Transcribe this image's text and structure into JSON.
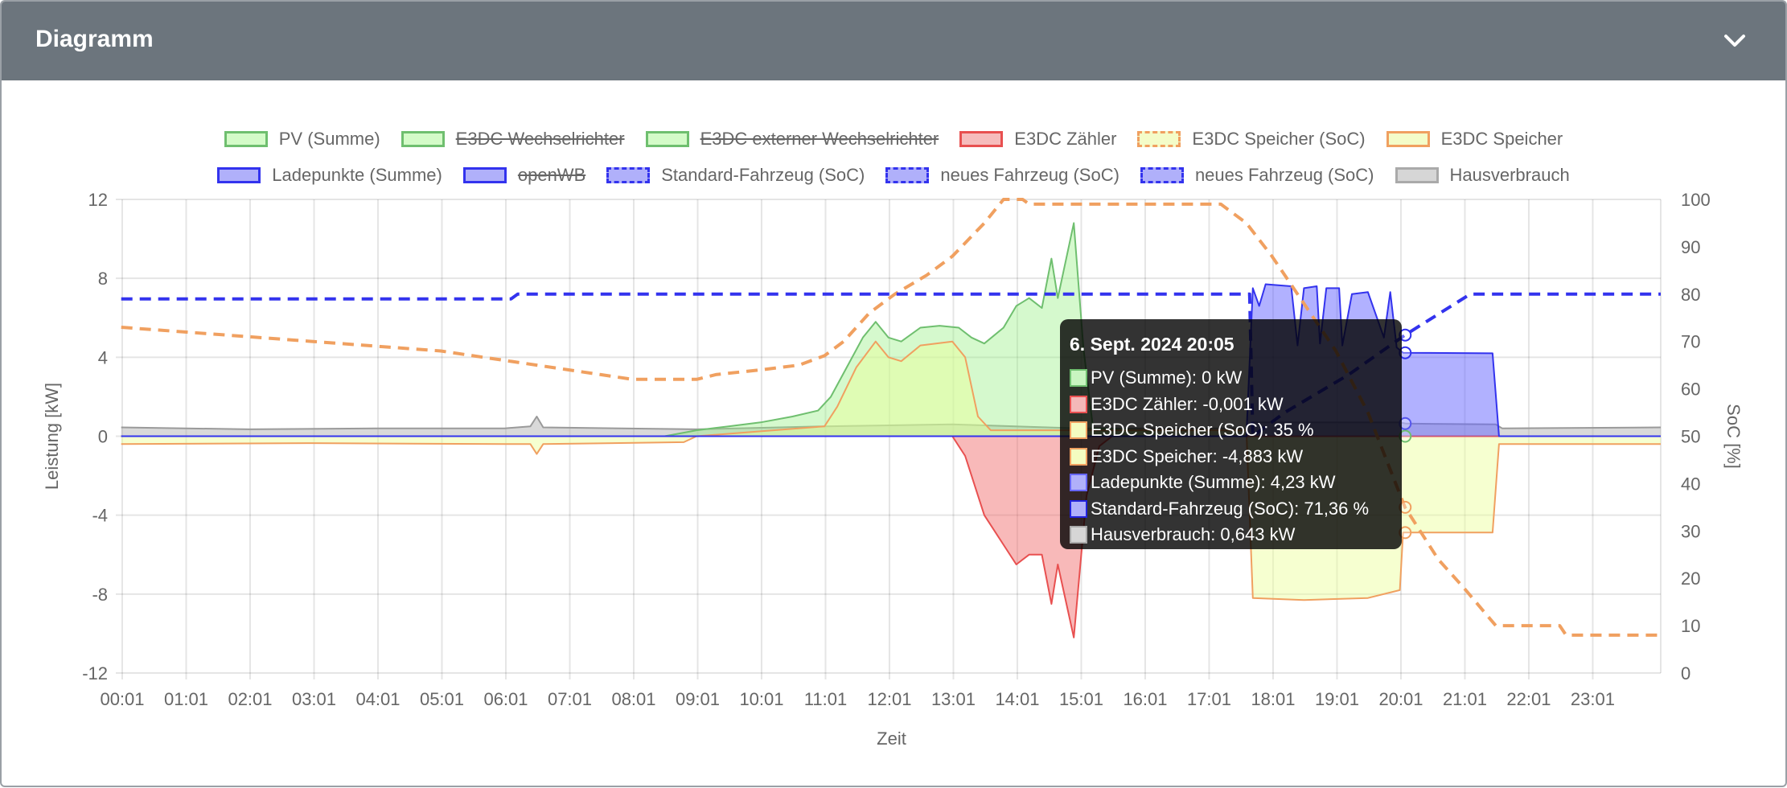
{
  "header": {
    "title": "Diagramm",
    "collapse_icon": "chevron-down-icon"
  },
  "legend": {
    "row1": [
      {
        "label": "PV (Summe)",
        "hidden": false,
        "stroke": "#6fbf6f",
        "fill": "#d4fbc8",
        "dashed": false
      },
      {
        "label": "E3DC Wechselrichter",
        "hidden": true,
        "stroke": "#6fbf6f",
        "fill": "#d4fbc8",
        "dashed": false
      },
      {
        "label": "E3DC externer Wechselrichter",
        "hidden": true,
        "stroke": "#6fbf6f",
        "fill": "#d4fbc8",
        "dashed": false
      },
      {
        "label": "E3DC Zähler",
        "hidden": false,
        "stroke": "#e85050",
        "fill": "#f6bcbc",
        "dashed": false
      },
      {
        "label": "E3DC Speicher (SoC)",
        "hidden": false,
        "stroke": "#f0a060",
        "fill": "#f4fcc8",
        "dashed": true
      },
      {
        "label": "E3DC Speicher",
        "hidden": false,
        "stroke": "#f0a060",
        "fill": "#f4fcc8",
        "dashed": false
      }
    ],
    "row2": [
      {
        "label": "Ladepunkte (Summe)",
        "hidden": false,
        "stroke": "#3333ee",
        "fill": "#b0b0fa",
        "dashed": false
      },
      {
        "label": "openWB",
        "hidden": true,
        "stroke": "#3333ee",
        "fill": "#b0b0fa",
        "dashed": false
      },
      {
        "label": "Standard-Fahrzeug (SoC)",
        "hidden": false,
        "stroke": "#3333ee",
        "fill": "#b0b0fa",
        "dashed": true
      },
      {
        "label": "neues Fahrzeug (SoC)",
        "hidden": false,
        "stroke": "#3333ee",
        "fill": "#b0b0fa",
        "dashed": true
      },
      {
        "label": "neues Fahrzeug (SoC)",
        "hidden": false,
        "stroke": "#3333ee",
        "fill": "#b0b0fa",
        "dashed": true
      },
      {
        "label": "Hausverbrauch",
        "hidden": false,
        "stroke": "#aaaaaa",
        "fill": "#d6d6d6",
        "dashed": false
      }
    ]
  },
  "tooltip": {
    "title": "6. Sept. 2024 20:05",
    "rows": [
      {
        "text": "PV (Summe): 0 kW",
        "stroke": "#6fbf6f",
        "fill": "#c8f5c0"
      },
      {
        "text": "E3DC Zähler: -0,001 kW",
        "stroke": "#e85050",
        "fill": "#f4b8b8"
      },
      {
        "text": "E3DC Speicher (SoC): 35 %",
        "stroke": "#f0a060",
        "fill": "#f4fcc0"
      },
      {
        "text": "E3DC Speicher: -4,883 kW",
        "stroke": "#f0a060",
        "fill": "#f4fcc0"
      },
      {
        "text": "Ladepunkte (Summe): 4,23 kW",
        "stroke": "#6666ff",
        "fill": "#b0b0fa"
      },
      {
        "text": "Standard-Fahrzeug (SoC): 71,36 %",
        "stroke": "#2222dd",
        "fill": "#b0b0fa"
      },
      {
        "text": "Hausverbrauch: 0,643 kW",
        "stroke": "#aaaaaa",
        "fill": "#d6d6d6"
      }
    ],
    "time_h": 20.083
  },
  "chart_data": {
    "type": "area",
    "xlabel": "Zeit",
    "ylabel": "Leistung [kW]",
    "y2label": "SoC [%]",
    "ylim": [
      -12,
      12
    ],
    "yticks": [
      "12",
      "8",
      "4",
      "0",
      "-4",
      "-8",
      "-12"
    ],
    "y2lim": [
      0,
      100
    ],
    "y2ticks": [
      "100",
      "90",
      "80",
      "70",
      "60",
      "50",
      "40",
      "30",
      "20",
      "10",
      "0"
    ],
    "xlim_hours": [
      0.0167,
      24.08
    ],
    "xticks": [
      "00:01",
      "01:01",
      "02:01",
      "03:01",
      "04:01",
      "05:01",
      "06:01",
      "07:01",
      "08:01",
      "09:01",
      "10:01",
      "11:01",
      "12:01",
      "13:01",
      "14:01",
      "15:01",
      "16:01",
      "17:01",
      "18:01",
      "19:01",
      "20:01",
      "21:01",
      "22:01",
      "23:01"
    ],
    "grid": true,
    "legend_position": "top",
    "series": [
      {
        "name": "Hausverbrauch",
        "axis": "kW",
        "fill": true,
        "stroke": "#9a9a9a",
        "fillColor": "rgba(170,170,170,0.45)",
        "dashed": false,
        "points": [
          [
            0,
            0.45
          ],
          [
            2,
            0.35
          ],
          [
            4,
            0.4
          ],
          [
            6,
            0.4
          ],
          [
            6.4,
            0.5
          ],
          [
            6.5,
            1.0
          ],
          [
            6.6,
            0.45
          ],
          [
            9,
            0.35
          ],
          [
            11,
            0.5
          ],
          [
            13,
            0.6
          ],
          [
            15,
            0.4
          ],
          [
            17.6,
            0.4
          ],
          [
            17.7,
            0.7
          ],
          [
            20,
            0.7
          ],
          [
            20.1,
            0.64
          ],
          [
            21.5,
            0.6
          ],
          [
            21.6,
            0.4
          ],
          [
            24.1,
            0.45
          ]
        ]
      },
      {
        "name": "PV (Summe)",
        "axis": "kW",
        "fill": true,
        "stroke": "#6fbf6f",
        "fillColor": "rgba(150,240,130,0.4)",
        "dashed": false,
        "points": [
          [
            0,
            0
          ],
          [
            8.5,
            0
          ],
          [
            9,
            0.3
          ],
          [
            9.5,
            0.5
          ],
          [
            10,
            0.7
          ],
          [
            10.5,
            1.0
          ],
          [
            10.9,
            1.3
          ],
          [
            11.1,
            2.0
          ],
          [
            11.3,
            3.2
          ],
          [
            11.6,
            5.0
          ],
          [
            11.8,
            5.8
          ],
          [
            12,
            5.0
          ],
          [
            12.2,
            4.8
          ],
          [
            12.5,
            5.5
          ],
          [
            12.8,
            5.6
          ],
          [
            13.1,
            5.5
          ],
          [
            13.3,
            5.0
          ],
          [
            13.5,
            4.7
          ],
          [
            13.8,
            5.5
          ],
          [
            14,
            6.6
          ],
          [
            14.2,
            7.0
          ],
          [
            14.4,
            6.5
          ],
          [
            14.55,
            9.0
          ],
          [
            14.65,
            7.0
          ],
          [
            14.9,
            10.8
          ],
          [
            15.05,
            4.5
          ],
          [
            15.2,
            0.4
          ],
          [
            16,
            0.3
          ],
          [
            16.3,
            0
          ],
          [
            24.1,
            0
          ]
        ]
      },
      {
        "name": "E3DC Speicher",
        "axis": "kW",
        "fill": true,
        "stroke": "#f0a060",
        "fillColor": "rgba(235,255,150,0.45)",
        "dashed": false,
        "points": [
          [
            0,
            -0.4
          ],
          [
            3,
            -0.35
          ],
          [
            6,
            -0.4
          ],
          [
            6.4,
            -0.4
          ],
          [
            6.5,
            -0.9
          ],
          [
            6.6,
            -0.4
          ],
          [
            8.8,
            -0.3
          ],
          [
            9,
            0
          ],
          [
            11,
            0.5
          ],
          [
            11.2,
            1.5
          ],
          [
            11.5,
            3.5
          ],
          [
            11.8,
            4.8
          ],
          [
            12,
            4.0
          ],
          [
            12.2,
            3.8
          ],
          [
            12.5,
            4.6
          ],
          [
            13,
            4.8
          ],
          [
            13.2,
            4.0
          ],
          [
            13.4,
            1.0
          ],
          [
            13.6,
            0.3
          ],
          [
            17.6,
            0.3
          ],
          [
            17.7,
            -8.2
          ],
          [
            18.5,
            -8.3
          ],
          [
            19.5,
            -8.2
          ],
          [
            20,
            -7.8
          ],
          [
            20.05,
            -4.88
          ],
          [
            21.45,
            -4.88
          ],
          [
            21.55,
            -0.4
          ],
          [
            24.1,
            -0.4
          ]
        ]
      },
      {
        "name": "E3DC Zähler",
        "axis": "kW",
        "fill": true,
        "stroke": "#e85050",
        "fillColor": "rgba(240,100,100,0.45)",
        "dashed": false,
        "points": [
          [
            0,
            0
          ],
          [
            13,
            0
          ],
          [
            13.2,
            -1
          ],
          [
            13.5,
            -4
          ],
          [
            13.8,
            -5.5
          ],
          [
            14,
            -6.5
          ],
          [
            14.2,
            -6
          ],
          [
            14.4,
            -6
          ],
          [
            14.55,
            -8.5
          ],
          [
            14.65,
            -6.5
          ],
          [
            14.9,
            -10.2
          ],
          [
            15.1,
            -3
          ],
          [
            15.3,
            -0.5
          ],
          [
            15.5,
            0
          ],
          [
            24.1,
            0
          ]
        ]
      },
      {
        "name": "Ladepunkte (Summe)",
        "axis": "kW",
        "fill": true,
        "stroke": "#3333ee",
        "fillColor": "rgba(100,100,255,0.5)",
        "dashed": false,
        "points": [
          [
            0,
            0
          ],
          [
            17.6,
            0
          ],
          [
            17.7,
            7.5
          ],
          [
            17.8,
            6.6
          ],
          [
            17.9,
            7.7
          ],
          [
            18.3,
            7.6
          ],
          [
            18.4,
            4.6
          ],
          [
            18.5,
            7.5
          ],
          [
            18.7,
            7.6
          ],
          [
            18.75,
            4.7
          ],
          [
            18.85,
            7.5
          ],
          [
            19.05,
            7.5
          ],
          [
            19.1,
            4.6
          ],
          [
            19.25,
            7.2
          ],
          [
            19.5,
            7.3
          ],
          [
            19.75,
            5.0
          ],
          [
            19.85,
            7.3
          ],
          [
            19.95,
            4.5
          ],
          [
            20.05,
            4.23
          ],
          [
            21.45,
            4.2
          ],
          [
            21.55,
            0
          ],
          [
            24.1,
            0
          ]
        ]
      },
      {
        "name": "E3DC Speicher (SoC)",
        "axis": "pct",
        "fill": false,
        "stroke": "#f0a060",
        "dashed": true,
        "points": [
          [
            0,
            73
          ],
          [
            1,
            72
          ],
          [
            2,
            71
          ],
          [
            3,
            70
          ],
          [
            4,
            69
          ],
          [
            5,
            68
          ],
          [
            5.5,
            67
          ],
          [
            6.5,
            65
          ],
          [
            7,
            64
          ],
          [
            7.5,
            63
          ],
          [
            8,
            62
          ],
          [
            9,
            62
          ],
          [
            9.3,
            63
          ],
          [
            10,
            64
          ],
          [
            10.6,
            65
          ],
          [
            11,
            67
          ],
          [
            11.3,
            70
          ],
          [
            11.7,
            76
          ],
          [
            12.1,
            80
          ],
          [
            12.6,
            84
          ],
          [
            13,
            88
          ],
          [
            13.5,
            95
          ],
          [
            13.8,
            100
          ],
          [
            14.1,
            100
          ],
          [
            14.2,
            99
          ],
          [
            17.2,
            99
          ],
          [
            17.6,
            95
          ],
          [
            18,
            88
          ],
          [
            18.5,
            78
          ],
          [
            19,
            68
          ],
          [
            19.5,
            55
          ],
          [
            20.08,
            35
          ],
          [
            20.6,
            24
          ],
          [
            21,
            18
          ],
          [
            21.5,
            10
          ],
          [
            22.5,
            10
          ],
          [
            22.6,
            8
          ],
          [
            24.1,
            8
          ]
        ]
      },
      {
        "name": "Standard-Fahrzeug (SoC)",
        "axis": "pct",
        "fill": false,
        "stroke": "#3333ee",
        "dashed": true,
        "points": [
          [
            0,
            79
          ],
          [
            6.1,
            79
          ],
          [
            6.2,
            80
          ],
          [
            17.65,
            80
          ],
          [
            17.7,
            50
          ],
          [
            18.2,
            55
          ],
          [
            19.2,
            63
          ],
          [
            20.08,
            71.36
          ],
          [
            21.1,
            80
          ],
          [
            24.1,
            80
          ]
        ]
      }
    ],
    "markers_at_tooltip": [
      {
        "axis": "kW",
        "value": 0,
        "stroke": "#6fbf6f"
      },
      {
        "axis": "kW",
        "value": 0.643,
        "stroke": "#5555ee"
      },
      {
        "axis": "kW",
        "value": 4.23,
        "stroke": "#3333ee"
      },
      {
        "axis": "pct",
        "value": 71.36,
        "stroke": "#3333ee"
      },
      {
        "axis": "pct",
        "value": 35,
        "stroke": "#f0a060"
      },
      {
        "axis": "kW",
        "value": -4.883,
        "stroke": "#f0a060"
      }
    ]
  }
}
